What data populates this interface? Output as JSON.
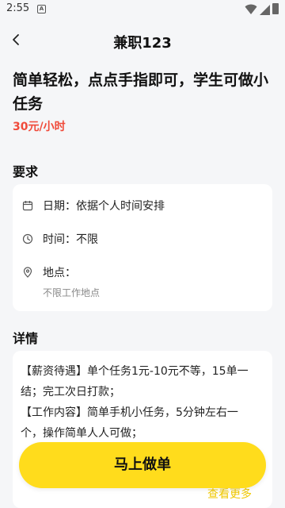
{
  "status_bar": {
    "time": "2:55",
    "notif_letter": "A"
  },
  "header": {
    "title": "兼职123"
  },
  "job": {
    "title": "简单轻松，点点手指即可，学生可做小任务",
    "salary": "30元/小时"
  },
  "requirements": {
    "section_title": "要求",
    "date": "日期：依据个人时间安排",
    "time": "时间：不限",
    "location": "地点：",
    "location_detail": "不限工作地点"
  },
  "details": {
    "section_title": "详情",
    "lines": [
      "【薪资待遇】单个任务1元-10元不等，15单一结；完工次日打款；",
      "【工作内容】简单手机小任务，5分钟左右一个，操作简单人人可做；"
    ],
    "more_label": "查看更多"
  },
  "cta": {
    "label": "马上做单"
  },
  "colors": {
    "accent": "#ffdc1c",
    "salary": "#f04a3a",
    "background": "#f5f6f8"
  }
}
